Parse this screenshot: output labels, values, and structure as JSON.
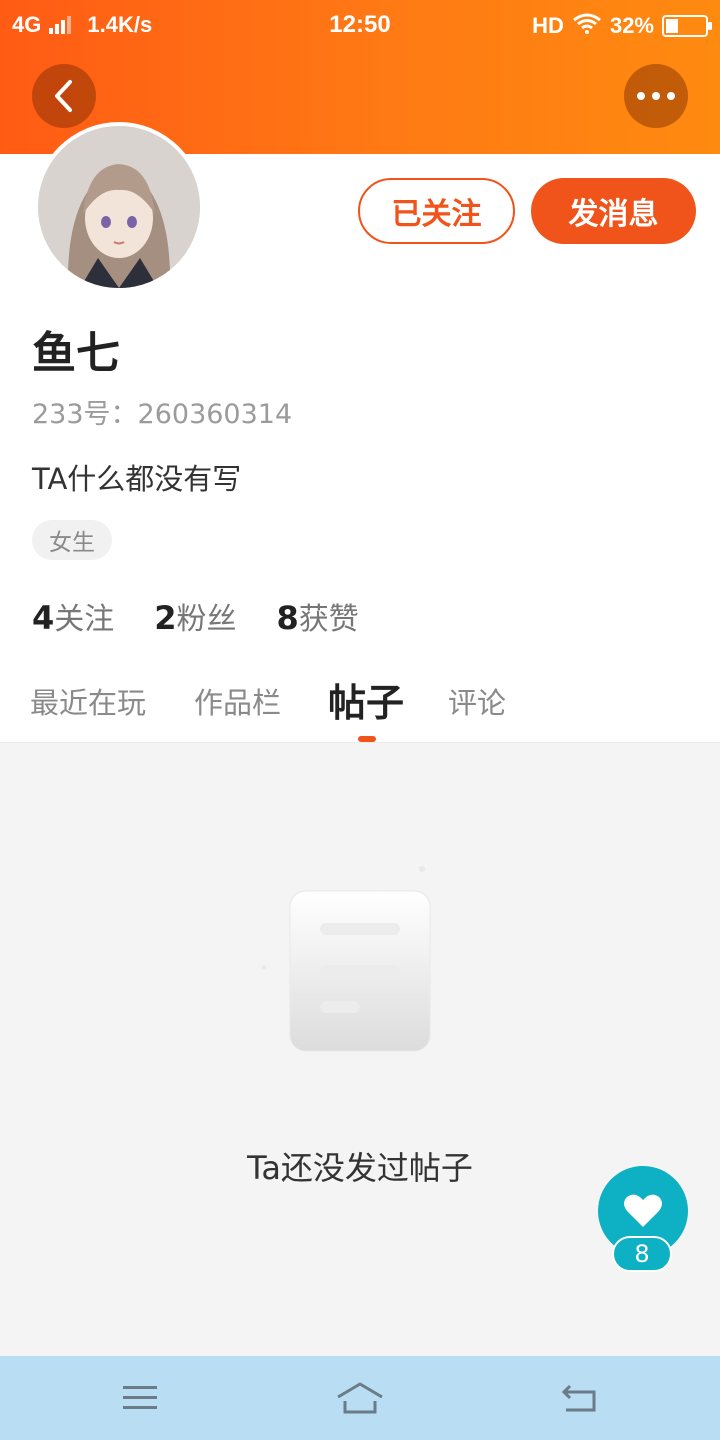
{
  "status_bar": {
    "network": "4G",
    "speed": "1.4K/s",
    "time": "12:50",
    "hd": "HD",
    "battery_percent": "32%",
    "battery_level": 0.32
  },
  "header": {
    "accent_color": "#ff6a14",
    "back_icon": "chevron-left-icon",
    "more_icon": "more-dots-icon"
  },
  "profile": {
    "follow_button": "已关注",
    "message_button": "发消息",
    "nickname": "鱼七",
    "account_id": "233号：260360314",
    "bio": "TA什么都没有写",
    "gender_tag": "女生",
    "stats": [
      {
        "value": "4",
        "label": "关注"
      },
      {
        "value": "2",
        "label": "粉丝"
      },
      {
        "value": "8",
        "label": "获赞"
      }
    ]
  },
  "tabs": [
    {
      "label": "最近在玩",
      "active": false
    },
    {
      "label": "作品栏",
      "active": false
    },
    {
      "label": "帖子",
      "active": true
    },
    {
      "label": "评论",
      "active": false
    }
  ],
  "content": {
    "empty_text": "Ta还没发过帖子"
  },
  "like_fab": {
    "count": "8",
    "color": "#0eb0c4"
  },
  "nav_bar": {
    "color": "#b9ddf2",
    "items": [
      "menu-icon",
      "home-icon",
      "back-icon"
    ]
  }
}
